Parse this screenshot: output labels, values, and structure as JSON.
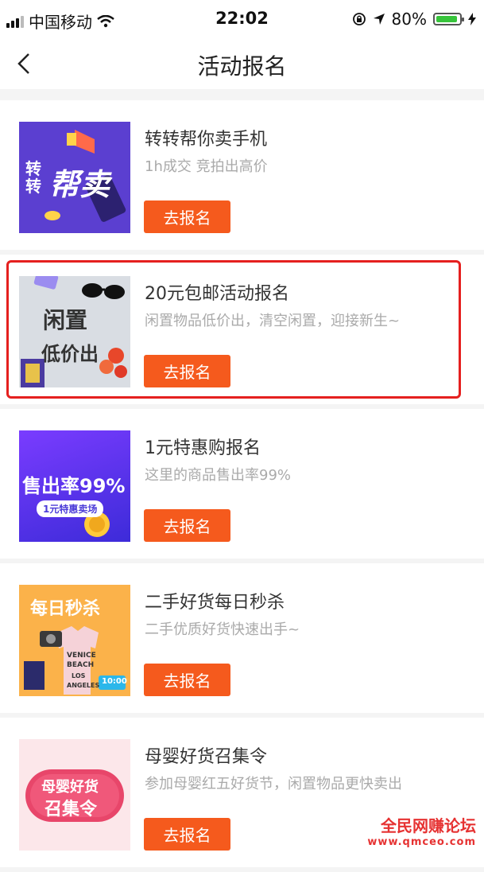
{
  "status_bar": {
    "carrier": "中国移动",
    "time": "22:02",
    "battery": "80%"
  },
  "nav": {
    "title": "活动报名"
  },
  "items": [
    {
      "title": "转转帮你卖手机",
      "subtitle": "1h成交 竞拍出高价",
      "button": "去报名",
      "thumb_text": [
        "转转",
        "帮卖"
      ]
    },
    {
      "title": "20元包邮活动报名",
      "subtitle": "闲置物品低价出，清空闲置，迎接新生~",
      "button": "去报名",
      "thumb_text": [
        "闲置",
        "低价出"
      ]
    },
    {
      "title": "1元特惠购报名",
      "subtitle": "这里的商品售出率99%",
      "button": "去报名",
      "thumb_text": [
        "售出率99%",
        "1元特惠卖场"
      ]
    },
    {
      "title": "二手好货每日秒杀",
      "subtitle": "二手优质好货快速出手~",
      "button": "去报名",
      "thumb_text": [
        "每日秒杀",
        "VENICE",
        "BEACH",
        "LOS",
        "ANGELES",
        "10:00"
      ]
    },
    {
      "title": "母婴好货召集令",
      "subtitle": "参加母婴红五好货节，闲置物品更快卖出",
      "button": "去报名",
      "thumb_text": [
        "母婴好货",
        "召集令"
      ]
    }
  ],
  "watermark": {
    "line1": "全民网赚论坛",
    "line2": "www.qmceo.com"
  },
  "colors": {
    "accent": "#f55a1d",
    "highlight_border": "#e5201f"
  }
}
